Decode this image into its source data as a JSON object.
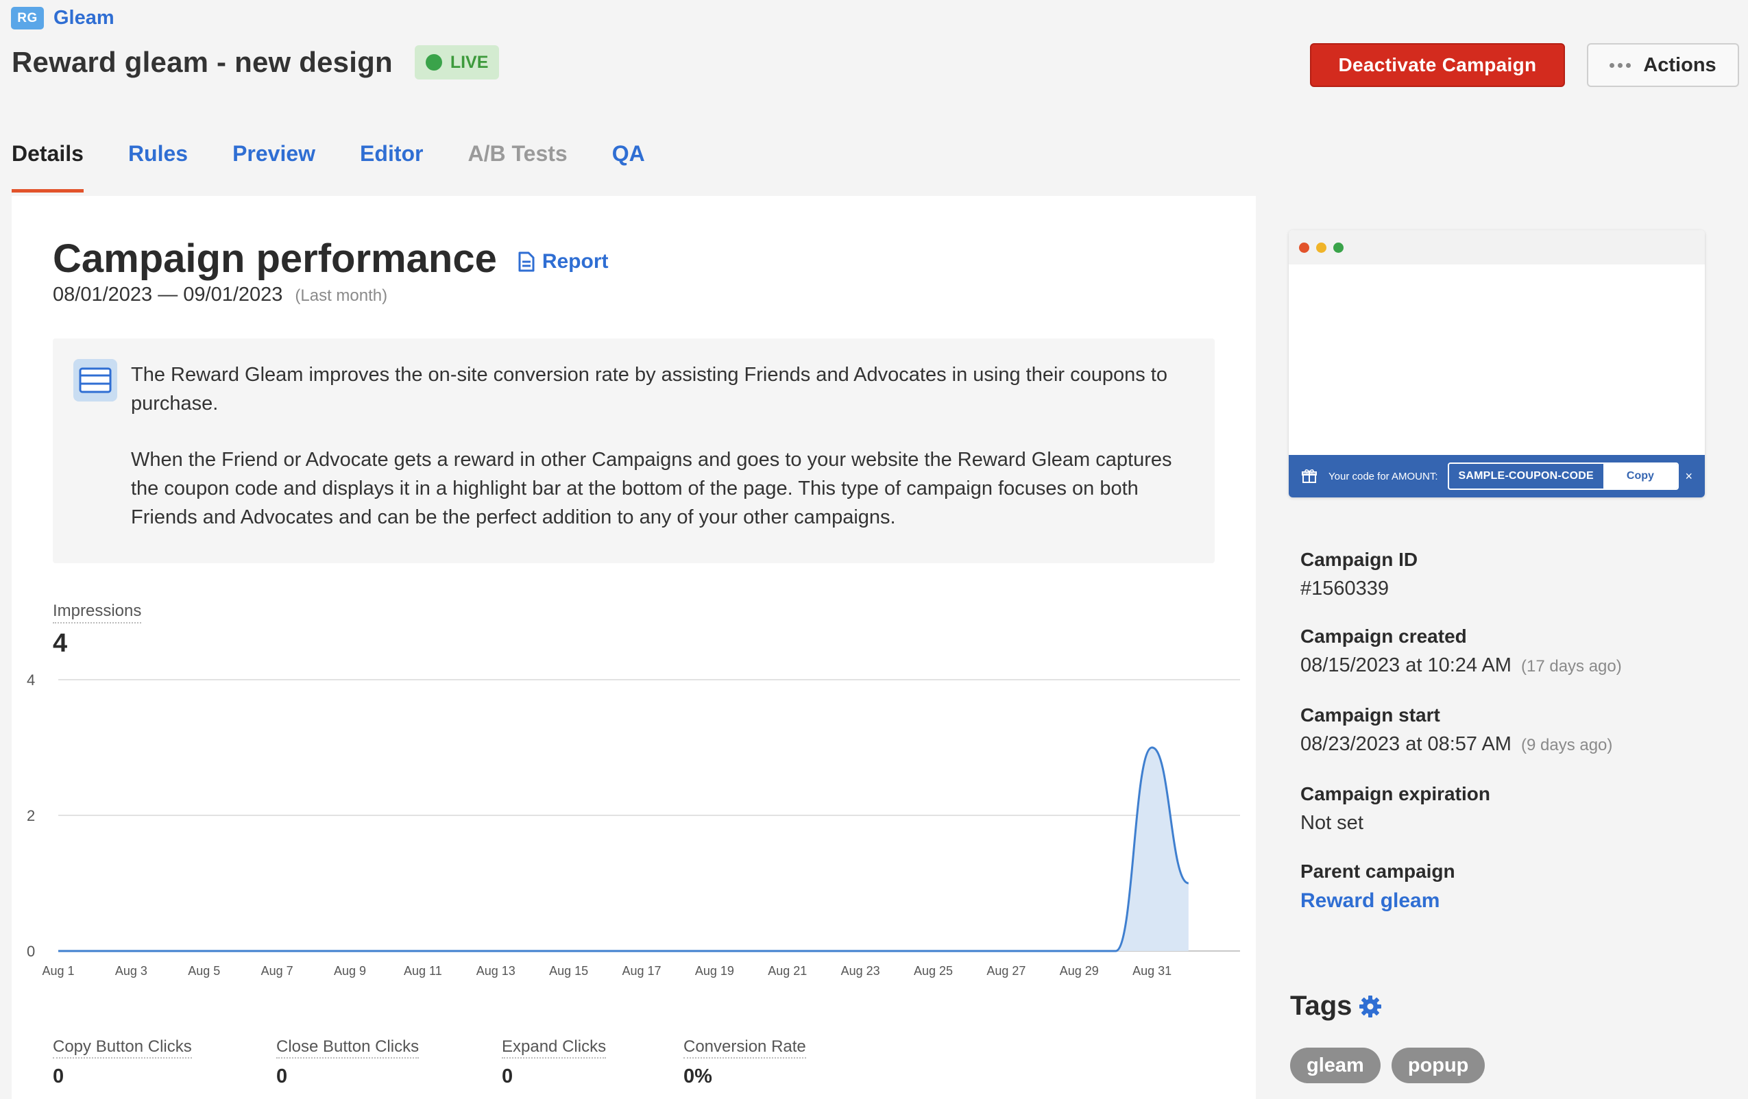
{
  "brand": {
    "badge": "RG",
    "name": "Gleam"
  },
  "campaign": {
    "title": "Reward gleam - new design",
    "status": "LIVE"
  },
  "header": {
    "deactivate_label": "Deactivate Campaign",
    "actions_label": "Actions"
  },
  "tabs": [
    {
      "label": "Details",
      "state": "active"
    },
    {
      "label": "Rules",
      "state": "link"
    },
    {
      "label": "Preview",
      "state": "link"
    },
    {
      "label": "Editor",
      "state": "link"
    },
    {
      "label": "A/B Tests",
      "state": "disabled"
    },
    {
      "label": "QA",
      "state": "link"
    }
  ],
  "performance": {
    "title": "Campaign performance",
    "report_label": "Report",
    "date_range": "08/01/2023 — 09/01/2023",
    "date_hint": "(Last month)",
    "info_p1": "The Reward Gleam improves the on-site conversion rate by assisting Friends and Advocates in using their coupons to purchase.",
    "info_p2": "When the Friend or Advocate gets a reward in other Campaigns and goes to your website the Reward Gleam captures the coupon code and displays it in a highlight bar at the bottom of the page. This type of campaign focuses on both Friends and Advocates and can be the perfect addition to any of your other campaigns.",
    "impressions_label": "Impressions",
    "impressions_value": "4"
  },
  "chart_data": {
    "type": "area",
    "x_ticks": [
      "Aug 1",
      "Aug 3",
      "Aug 5",
      "Aug 7",
      "Aug 9",
      "Aug 11",
      "Aug 13",
      "Aug 15",
      "Aug 17",
      "Aug 19",
      "Aug 21",
      "Aug 23",
      "Aug 25",
      "Aug 27",
      "Aug 29",
      "Aug 31"
    ],
    "y_ticks": [
      "0",
      "2",
      "4"
    ],
    "ylim": [
      0,
      4
    ],
    "x": [
      "Aug 1",
      "Aug 2",
      "Aug 3",
      "Aug 4",
      "Aug 5",
      "Aug 6",
      "Aug 7",
      "Aug 8",
      "Aug 9",
      "Aug 10",
      "Aug 11",
      "Aug 12",
      "Aug 13",
      "Aug 14",
      "Aug 15",
      "Aug 16",
      "Aug 17",
      "Aug 18",
      "Aug 19",
      "Aug 20",
      "Aug 21",
      "Aug 22",
      "Aug 23",
      "Aug 24",
      "Aug 25",
      "Aug 26",
      "Aug 27",
      "Aug 28",
      "Aug 29",
      "Aug 30",
      "Aug 31",
      "Sep 1"
    ],
    "values": [
      0,
      0,
      0,
      0,
      0,
      0,
      0,
      0,
      0,
      0,
      0,
      0,
      0,
      0,
      0,
      0,
      0,
      0,
      0,
      0,
      0,
      0,
      0,
      0,
      0,
      0,
      0,
      0,
      0,
      0,
      3,
      1
    ],
    "grid": true,
    "color": "#3f7fcf",
    "fill": "#d9e6f5"
  },
  "metrics": [
    {
      "label": "Copy Button Clicks",
      "value": "0"
    },
    {
      "label": "Close Button Clicks",
      "value": "0"
    },
    {
      "label": "Expand Clicks",
      "value": "0"
    },
    {
      "label": "Conversion Rate",
      "value": "0%"
    }
  ],
  "preview_bar": {
    "label": "Your code for AMOUNT:",
    "code": "SAMPLE-COUPON-CODE",
    "copy_label": "Copy",
    "close_glyph": "×"
  },
  "facts": {
    "id_label": "Campaign ID",
    "id_value": "#1560339",
    "created_label": "Campaign created",
    "created_value": "08/15/2023 at 10:24 AM",
    "created_ago": "(17 days ago)",
    "start_label": "Campaign start",
    "start_value": "08/23/2023 at 08:57 AM",
    "start_ago": "(9 days ago)",
    "expiration_label": "Campaign expiration",
    "expiration_value": "Not set",
    "parent_label": "Parent campaign",
    "parent_value": "Reward gleam"
  },
  "tags": {
    "title": "Tags",
    "items": [
      "gleam",
      "popup"
    ]
  },
  "colors": {
    "accent": "#2f6ed3",
    "danger": "#d32b1e",
    "live": "#3aa34a",
    "tab_underline": "#e2532b"
  }
}
